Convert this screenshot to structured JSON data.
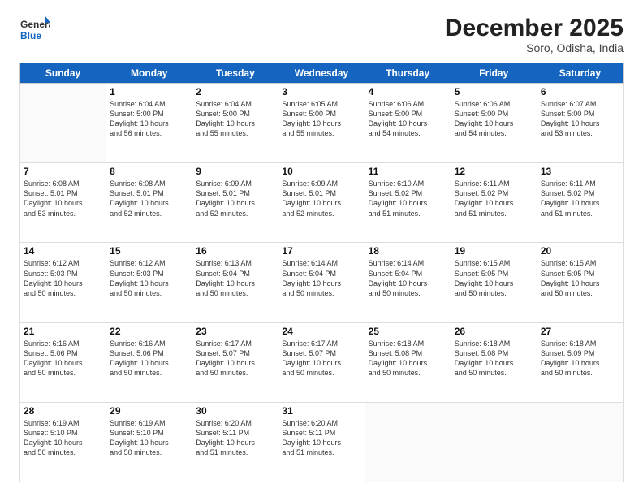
{
  "logo": {
    "general": "General",
    "blue": "Blue"
  },
  "title": "December 2025",
  "location": "Soro, Odisha, India",
  "days_of_week": [
    "Sunday",
    "Monday",
    "Tuesday",
    "Wednesday",
    "Thursday",
    "Friday",
    "Saturday"
  ],
  "weeks": [
    [
      {
        "day": "",
        "info": ""
      },
      {
        "day": "1",
        "info": "Sunrise: 6:04 AM\nSunset: 5:00 PM\nDaylight: 10 hours\nand 56 minutes."
      },
      {
        "day": "2",
        "info": "Sunrise: 6:04 AM\nSunset: 5:00 PM\nDaylight: 10 hours\nand 55 minutes."
      },
      {
        "day": "3",
        "info": "Sunrise: 6:05 AM\nSunset: 5:00 PM\nDaylight: 10 hours\nand 55 minutes."
      },
      {
        "day": "4",
        "info": "Sunrise: 6:06 AM\nSunset: 5:00 PM\nDaylight: 10 hours\nand 54 minutes."
      },
      {
        "day": "5",
        "info": "Sunrise: 6:06 AM\nSunset: 5:00 PM\nDaylight: 10 hours\nand 54 minutes."
      },
      {
        "day": "6",
        "info": "Sunrise: 6:07 AM\nSunset: 5:00 PM\nDaylight: 10 hours\nand 53 minutes."
      }
    ],
    [
      {
        "day": "7",
        "info": "Sunrise: 6:08 AM\nSunset: 5:01 PM\nDaylight: 10 hours\nand 53 minutes."
      },
      {
        "day": "8",
        "info": "Sunrise: 6:08 AM\nSunset: 5:01 PM\nDaylight: 10 hours\nand 52 minutes."
      },
      {
        "day": "9",
        "info": "Sunrise: 6:09 AM\nSunset: 5:01 PM\nDaylight: 10 hours\nand 52 minutes."
      },
      {
        "day": "10",
        "info": "Sunrise: 6:09 AM\nSunset: 5:01 PM\nDaylight: 10 hours\nand 52 minutes."
      },
      {
        "day": "11",
        "info": "Sunrise: 6:10 AM\nSunset: 5:02 PM\nDaylight: 10 hours\nand 51 minutes."
      },
      {
        "day": "12",
        "info": "Sunrise: 6:11 AM\nSunset: 5:02 PM\nDaylight: 10 hours\nand 51 minutes."
      },
      {
        "day": "13",
        "info": "Sunrise: 6:11 AM\nSunset: 5:02 PM\nDaylight: 10 hours\nand 51 minutes."
      }
    ],
    [
      {
        "day": "14",
        "info": "Sunrise: 6:12 AM\nSunset: 5:03 PM\nDaylight: 10 hours\nand 50 minutes."
      },
      {
        "day": "15",
        "info": "Sunrise: 6:12 AM\nSunset: 5:03 PM\nDaylight: 10 hours\nand 50 minutes."
      },
      {
        "day": "16",
        "info": "Sunrise: 6:13 AM\nSunset: 5:04 PM\nDaylight: 10 hours\nand 50 minutes."
      },
      {
        "day": "17",
        "info": "Sunrise: 6:14 AM\nSunset: 5:04 PM\nDaylight: 10 hours\nand 50 minutes."
      },
      {
        "day": "18",
        "info": "Sunrise: 6:14 AM\nSunset: 5:04 PM\nDaylight: 10 hours\nand 50 minutes."
      },
      {
        "day": "19",
        "info": "Sunrise: 6:15 AM\nSunset: 5:05 PM\nDaylight: 10 hours\nand 50 minutes."
      },
      {
        "day": "20",
        "info": "Sunrise: 6:15 AM\nSunset: 5:05 PM\nDaylight: 10 hours\nand 50 minutes."
      }
    ],
    [
      {
        "day": "21",
        "info": "Sunrise: 6:16 AM\nSunset: 5:06 PM\nDaylight: 10 hours\nand 50 minutes."
      },
      {
        "day": "22",
        "info": "Sunrise: 6:16 AM\nSunset: 5:06 PM\nDaylight: 10 hours\nand 50 minutes."
      },
      {
        "day": "23",
        "info": "Sunrise: 6:17 AM\nSunset: 5:07 PM\nDaylight: 10 hours\nand 50 minutes."
      },
      {
        "day": "24",
        "info": "Sunrise: 6:17 AM\nSunset: 5:07 PM\nDaylight: 10 hours\nand 50 minutes."
      },
      {
        "day": "25",
        "info": "Sunrise: 6:18 AM\nSunset: 5:08 PM\nDaylight: 10 hours\nand 50 minutes."
      },
      {
        "day": "26",
        "info": "Sunrise: 6:18 AM\nSunset: 5:08 PM\nDaylight: 10 hours\nand 50 minutes."
      },
      {
        "day": "27",
        "info": "Sunrise: 6:18 AM\nSunset: 5:09 PM\nDaylight: 10 hours\nand 50 minutes."
      }
    ],
    [
      {
        "day": "28",
        "info": "Sunrise: 6:19 AM\nSunset: 5:10 PM\nDaylight: 10 hours\nand 50 minutes."
      },
      {
        "day": "29",
        "info": "Sunrise: 6:19 AM\nSunset: 5:10 PM\nDaylight: 10 hours\nand 50 minutes."
      },
      {
        "day": "30",
        "info": "Sunrise: 6:20 AM\nSunset: 5:11 PM\nDaylight: 10 hours\nand 51 minutes."
      },
      {
        "day": "31",
        "info": "Sunrise: 6:20 AM\nSunset: 5:11 PM\nDaylight: 10 hours\nand 51 minutes."
      },
      {
        "day": "",
        "info": ""
      },
      {
        "day": "",
        "info": ""
      },
      {
        "day": "",
        "info": ""
      }
    ]
  ]
}
